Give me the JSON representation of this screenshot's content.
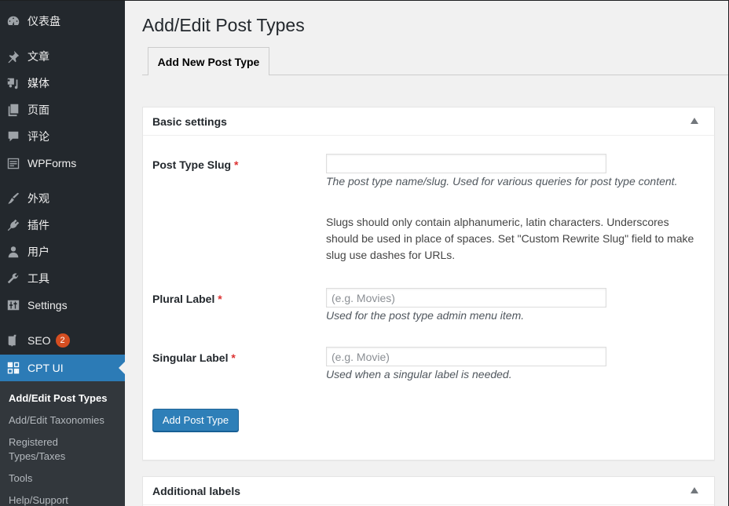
{
  "sidebar": {
    "items": [
      {
        "label": "仪表盘",
        "icon": "dashboard-icon"
      },
      {
        "label": "文章",
        "icon": "pin-icon"
      },
      {
        "label": "媒体",
        "icon": "media-icon"
      },
      {
        "label": "页面",
        "icon": "pages-icon"
      },
      {
        "label": "评论",
        "icon": "comment-icon"
      },
      {
        "label": "WPForms",
        "icon": "wpforms-icon"
      },
      {
        "label": "外观",
        "icon": "paintbrush-icon"
      },
      {
        "label": "插件",
        "icon": "plugin-icon"
      },
      {
        "label": "用户",
        "icon": "user-icon"
      },
      {
        "label": "工具",
        "icon": "wrench-icon"
      },
      {
        "label": "Settings",
        "icon": "settings-icon"
      },
      {
        "label": "SEO",
        "icon": "yoast-icon",
        "badge": "2"
      },
      {
        "label": "CPT UI",
        "icon": "cptui-icon",
        "active": true
      }
    ],
    "submenu": [
      {
        "label": "Add/Edit Post Types",
        "current": true
      },
      {
        "label": "Add/Edit Taxonomies"
      },
      {
        "label": "Registered Types/Taxes"
      },
      {
        "label": "Tools"
      },
      {
        "label": "Help/Support"
      }
    ]
  },
  "main": {
    "title": "Add/Edit Post Types",
    "tab": "Add New Post Type",
    "basic_settings": {
      "header": "Basic settings",
      "fields": [
        {
          "label": "Post Type Slug",
          "required": "*",
          "value": "",
          "placeholder": "",
          "description": "The post type name/slug. Used for various queries for post type content.",
          "note": "Slugs should only contain alphanumeric, latin characters. Underscores should be used in place of spaces. Set \"Custom Rewrite Slug\" field to make slug use dashes for URLs."
        },
        {
          "label": "Plural Label",
          "required": "*",
          "value": "",
          "placeholder": "(e.g. Movies)",
          "description": "Used for the post type admin menu item."
        },
        {
          "label": "Singular Label",
          "required": "*",
          "value": "",
          "placeholder": "(e.g. Movie)",
          "description": "Used when a singular label is needed."
        }
      ],
      "submit_label": "Add Post Type"
    },
    "additional_labels": {
      "header": "Additional labels"
    }
  },
  "colors": {
    "sidebar_bg": "#23282d",
    "submenu_bg": "#32373c",
    "active_bg": "#2c7bb6",
    "badge": "#d54e21",
    "required": "#dc3232",
    "primary_button": "#2e7fb8"
  }
}
